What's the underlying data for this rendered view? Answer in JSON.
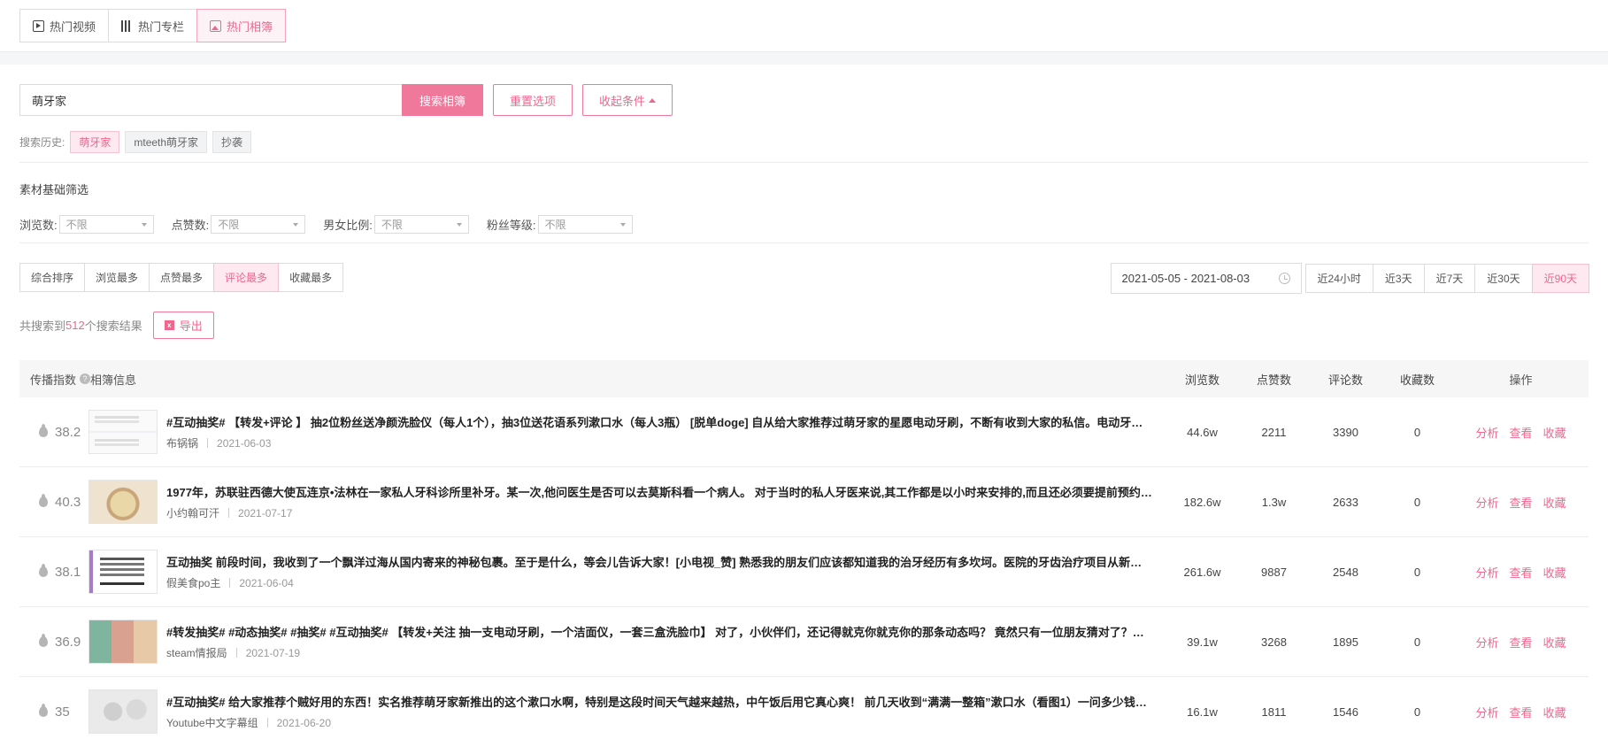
{
  "tabs": [
    {
      "label": "热门视频",
      "icon": "video-icon"
    },
    {
      "label": "热门专栏",
      "icon": "books-icon"
    },
    {
      "label": "热门相簿",
      "icon": "album-icon",
      "active": true
    }
  ],
  "search": {
    "value": "萌牙家",
    "button": "搜索相簿",
    "reset": "重置选项",
    "collapse": "收起条件"
  },
  "history": {
    "label": "搜索历史:",
    "items": [
      "萌牙家",
      "mteeth萌牙家",
      "抄袭"
    ]
  },
  "filters": {
    "title": "素材基础筛选",
    "items": [
      {
        "label": "浏览数:",
        "value": "不限"
      },
      {
        "label": "点赞数:",
        "value": "不限"
      },
      {
        "label": "男女比例:",
        "value": "不限"
      },
      {
        "label": "粉丝等级:",
        "value": "不限"
      }
    ]
  },
  "sort": {
    "tabs": [
      "综合排序",
      "浏览最多",
      "点赞最多",
      "评论最多",
      "收藏最多"
    ],
    "active": 3
  },
  "date": {
    "range": "2021-05-05 - 2021-08-03",
    "quick": [
      "近24小时",
      "近3天",
      "近7天",
      "近30天",
      "近90天"
    ],
    "active": 4
  },
  "results": {
    "prefix": "共搜索到",
    "count": "512",
    "suffix": "个搜索结果",
    "export": "导出"
  },
  "table": {
    "headers": {
      "index": "传播指数",
      "info": "相簿信息",
      "views": "浏览数",
      "likes": "点赞数",
      "comments": "评论数",
      "favorites": "收藏数",
      "ops": "操作"
    },
    "op_labels": [
      "分析",
      "查看",
      "收藏"
    ],
    "rows": [
      {
        "score": "38.2",
        "title": "#互动抽奖# 【转发+评论 】 抽2位粉丝送净颜洗脸仪（每人1个），抽3位送花语系列漱口水（每人3瓶） [脱单doge] 自从给大家推荐过萌牙家的星愿电动牙刷，不断有收到大家的私信。电动牙刷用了一段时间...",
        "author": "布锅锅",
        "date": "2021-06-03",
        "views": "44.6w",
        "likes": "2211",
        "comments": "3390",
        "favorites": "0"
      },
      {
        "score": "40.3",
        "title": "1977年，苏联驻西德大使瓦连京•法林在一家私人牙科诊所里补牙。某一次,他问医生是否可以去莫斯科看一个病人。 对于当时的私人牙医来说,其工作都是以小时来安排的,而且还必须要提前预约一个...",
        "author": "小约翰可汗",
        "date": "2021-07-17",
        "views": "182.6w",
        "likes": "1.3w",
        "comments": "2633",
        "favorites": "0"
      },
      {
        "score": "38.1",
        "title": "互动抽奖 前段时间，我收到了一个飘洋过海从国内寄来的神秘包裹。至于是什么，等会儿告诉大家！[小电视_赞]  熟悉我的朋友们应该都知道我的治牙经历有多坎坷。医院的牙齿治疗项目从新手级到...",
        "author": "假美食po主",
        "date": "2021-06-04",
        "views": "261.6w",
        "likes": "9887",
        "comments": "2548",
        "favorites": "0"
      },
      {
        "score": "36.9",
        "title": "#转发抽奖# #动态抽奖# #抽奖# #互动抽奖# 【转发+关注 抽一支电动牙刷，一个洁面仪，一套三盒洗脸巾】 对了，小伙伴们，还记得就克你就克你的那条动态吗？ 竟然只有一位朋友猜对了？还有...",
        "author": "steam情报局",
        "date": "2021-07-19",
        "views": "39.1w",
        "likes": "3268",
        "comments": "1895",
        "favorites": "0"
      },
      {
        "score": "35",
        "title": "#互动抽奖# 给大家推荐个贼好用的东西！实名推荐萌牙家新推出的这个漱口水啊，特别是这段时间天气越来越热，中午饭后用它真心爽！ 前几天收到“满满一整箱”漱口水（看图1）一问多少钱？...",
        "author": "Youtube中文字幕组",
        "date": "2021-06-20",
        "views": "16.1w",
        "likes": "1811",
        "comments": "1546",
        "favorites": "0"
      }
    ]
  },
  "colors": {
    "accent": "#f0668d",
    "accent_bg": "#fde9ef",
    "border": "#dcdcdc"
  }
}
